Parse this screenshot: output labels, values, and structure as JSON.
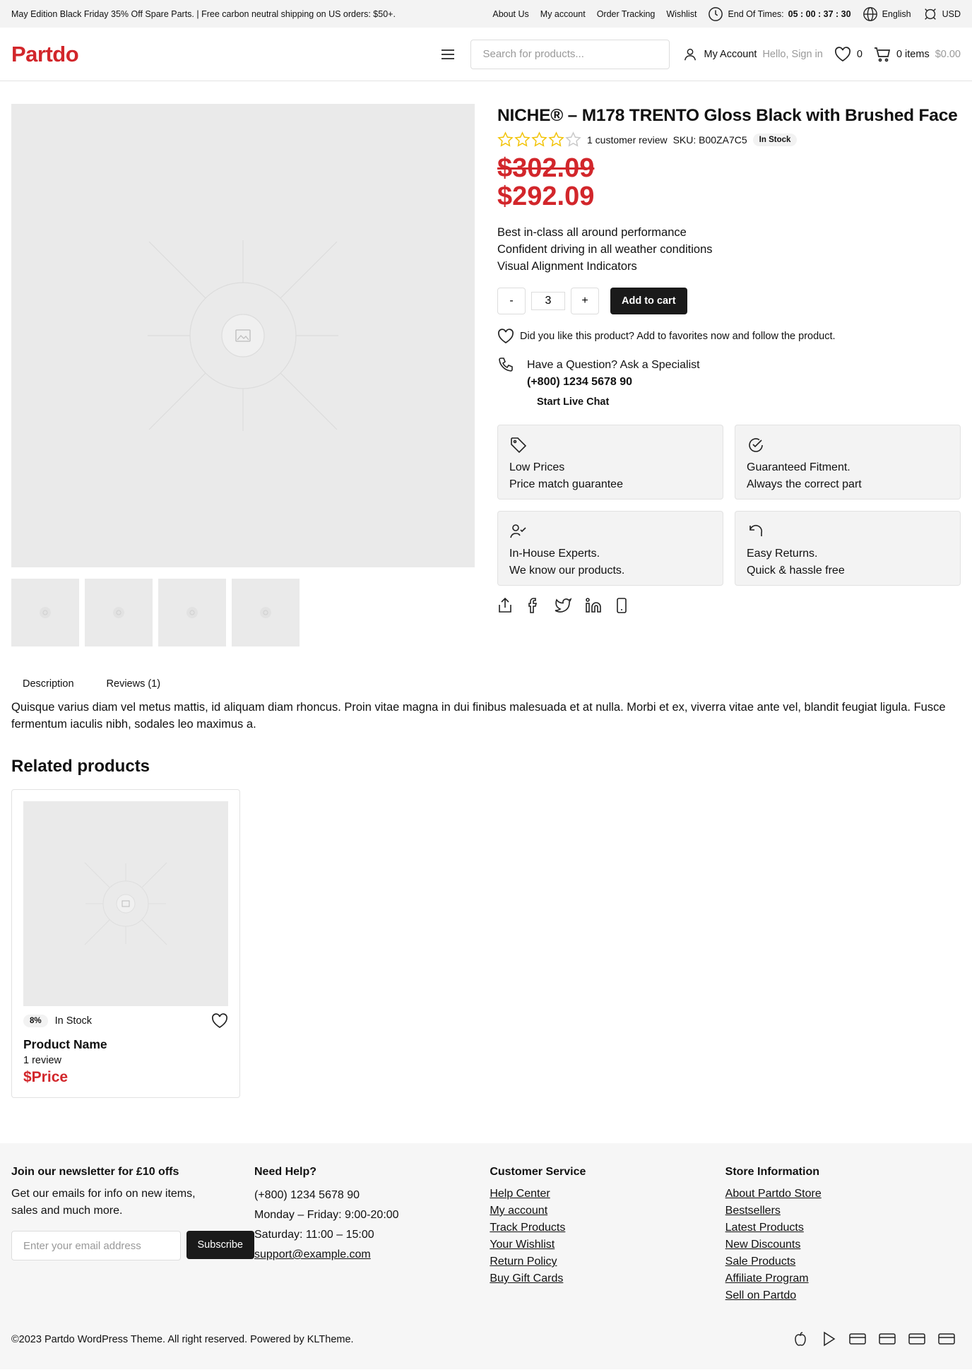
{
  "topbar": {
    "promo": "May Edition Black Friday 35% Off Spare Parts. | Free carbon neutral shipping on US orders: $50+.",
    "links": [
      "About Us",
      "My account",
      "Order Tracking",
      "Wishlist"
    ],
    "timer_label": "End Of Times:",
    "timer_value": "05 : 00 : 37 : 30",
    "language": "English",
    "currency": "USD"
  },
  "header": {
    "logo": "Partdo",
    "search_placeholder": "Search for products...",
    "account_label": "My Account",
    "account_hint": "Hello, Sign in",
    "wishlist_count": "0",
    "cart_items": "0 items",
    "cart_total": "$0.00"
  },
  "product": {
    "title": "NICHE® – M178 TRENTO Gloss Black with Brushed Face",
    "rating": 4,
    "reviews_text": "1 customer review",
    "sku": "SKU: B00ZA7C5",
    "stock": "In Stock",
    "old_price": "$302.09",
    "price": "$292.09",
    "features": [
      "Best in-class all around performance",
      "Confident driving in all weather conditions",
      "Visual Alignment Indicators"
    ],
    "qty_minus": "-",
    "qty_value": "3",
    "qty_plus": "+",
    "add_to_cart": "Add to cart",
    "favorite_text": "Did you like this product? Add to favorites now and follow the product.",
    "question_title": "Have a Question? Ask a Specialist",
    "question_phone": "(+800) 1234 5678 90",
    "live_chat": "Start Live Chat",
    "benefits": [
      {
        "icon": "tag-icon",
        "title": "Low Prices",
        "subtitle": "Price match guarantee"
      },
      {
        "icon": "check-circle-icon",
        "title": "Guaranteed Fitment.",
        "subtitle": "Always the correct part"
      },
      {
        "icon": "user-check-icon",
        "title": "In-House Experts.",
        "subtitle": "We know our products."
      },
      {
        "icon": "undo-icon",
        "title": "Easy Returns.",
        "subtitle": "Quick & hassle free"
      }
    ],
    "share_icons": [
      "share-icon",
      "facebook-icon",
      "twitter-icon",
      "linkedin-icon",
      "mobile-icon"
    ]
  },
  "tabs": [
    "Description",
    "Reviews (1)"
  ],
  "description": "Quisque varius diam vel metus mattis, id aliquam diam rhoncus. Proin vitae magna in dui finibus malesuada et at nulla. Morbi et ex, viverra vitae ante vel, blandit feugiat ligula. Fusce fermentum iaculis nibh, sodales leo maximus a.",
  "related": {
    "title": "Related products",
    "item": {
      "discount": "8%",
      "stock": "In Stock",
      "name": "Product Name",
      "reviews": "1 review",
      "price": "$Price"
    }
  },
  "footer": {
    "newsletter": {
      "title": "Join our newsletter for £10 offs",
      "text": "Get our emails for info on new items, sales and much more.",
      "placeholder": "Enter your email address",
      "button": "Subscribe"
    },
    "help": {
      "title": "Need Help?",
      "lines": [
        "(+800) 1234 5678 90",
        "Monday – Friday: 9:00-20:00",
        "Saturday: 11:00 – 15:00"
      ],
      "email": "support@example.com"
    },
    "service": {
      "title": "Customer Service",
      "links": [
        "Help Center",
        "My account",
        "Track Products",
        "Your Wishlist",
        "Return Policy",
        "Buy Gift Cards"
      ]
    },
    "store": {
      "title": "Store Information",
      "links": [
        "About Partdo Store",
        "Bestsellers",
        "Latest Products",
        "New Discounts",
        "Sale Products",
        "Affiliate Program",
        "Sell on Partdo"
      ]
    },
    "copyright": "©2023 Partdo WordPress Theme. All right reserved. Powered by KLTheme.",
    "payment_icons": [
      "apple-pay-icon",
      "google-play-icon",
      "card-icon",
      "card-icon",
      "card-icon",
      "card-icon"
    ]
  },
  "colors": {
    "accent": "#d2262b",
    "dark": "#1a1a1a",
    "star": "#f2c200"
  }
}
